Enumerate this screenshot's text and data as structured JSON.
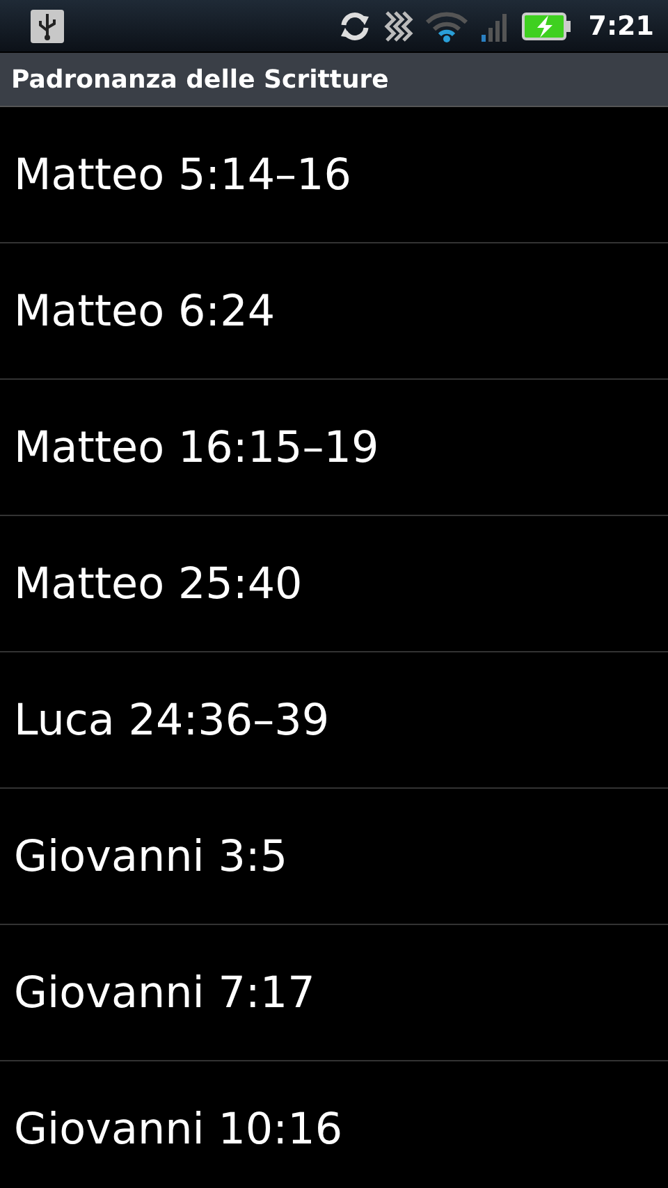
{
  "status_bar": {
    "time": "7:21"
  },
  "title_bar": {
    "title": "Padronanza delle Scritture"
  },
  "list": [
    {
      "label": "Matteo 5:14–16"
    },
    {
      "label": "Matteo 6:24"
    },
    {
      "label": "Matteo 16:15–19"
    },
    {
      "label": "Matteo 25:40"
    },
    {
      "label": "Luca 24:36–39"
    },
    {
      "label": "Giovanni 3:5"
    },
    {
      "label": "Giovanni 7:17"
    },
    {
      "label": "Giovanni 10:16"
    }
  ]
}
